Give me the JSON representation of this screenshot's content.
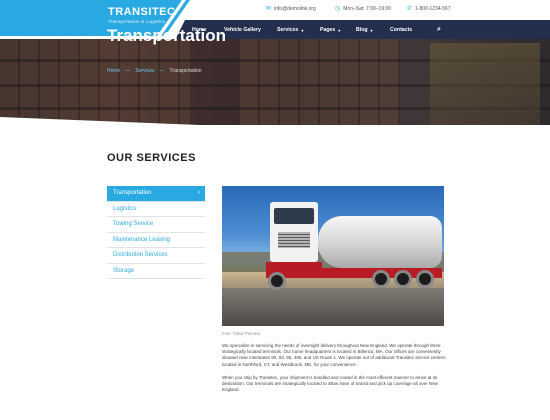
{
  "brand": {
    "name": "TRANSITEC",
    "tagline": "Transportation & Logistics",
    "accent": "#29a9e1",
    "nav_bg": "#232f4d"
  },
  "contacts": [
    {
      "icon": "envelope-icon",
      "text": "info@demolink.org"
    },
    {
      "icon": "clock-icon",
      "text": "Mon–Sat: 7:00–19:00"
    },
    {
      "icon": "phone-icon",
      "text": "1-800-1234-567"
    }
  ],
  "nav": {
    "items": [
      {
        "label": "Home",
        "dropdown": false
      },
      {
        "label": "Vehicle Gallery",
        "dropdown": false
      },
      {
        "label": "Services",
        "dropdown": true
      },
      {
        "label": "Pages",
        "dropdown": true
      },
      {
        "label": "Blog",
        "dropdown": true
      },
      {
        "label": "Contacts",
        "dropdown": false
      }
    ],
    "search_icon": "search-icon"
  },
  "hero": {
    "title": "Transportation",
    "breadcrumb": [
      "Home",
      "Services",
      "Transportation"
    ]
  },
  "main": {
    "section_title": "OUR SERVICES",
    "sidebar": [
      {
        "label": "Transportation",
        "active": true
      },
      {
        "label": "Logistics",
        "active": false
      },
      {
        "label": "Towing Service",
        "active": false
      },
      {
        "label": "Maintenance Leasing",
        "active": false
      },
      {
        "label": "Distribution Services",
        "active": false
      },
      {
        "label": "Storage",
        "active": false
      }
    ],
    "photo_caption": "Foto: Oskar Parrotta",
    "paragraphs": [
      "We specialize in servicing the needs of overnight delivery throughout New England. We operate through three strategically located terminals. Our home headquarters is located in Billerica, MA. Our offices are conveniently situated near interstates 90, 93, 95, 495, and US Route 1. We operate out of additional Transitec service centers located in Northford, CT, and Westbrook, ME, for your convenience.",
      "When you ship by Transitec, your shipment is handled and routed in the most efficient manner to arrive at its destination. Our terminals are strategically located to allow ease of transit and pick up coverage all over New England."
    ]
  }
}
